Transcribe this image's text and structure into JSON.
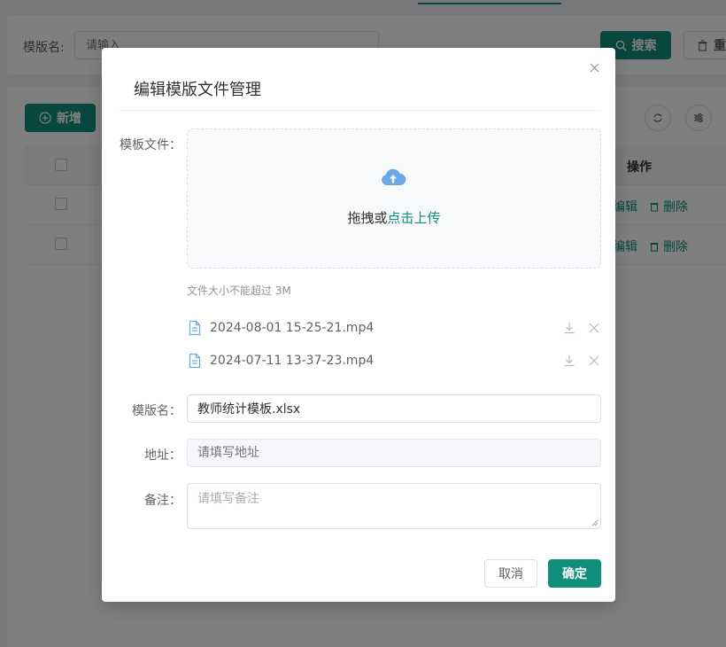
{
  "background": {
    "search": {
      "label": "模版名:",
      "placeholder": "请输入",
      "search_button": "搜索",
      "reset_button": "重置"
    },
    "toolbar": {
      "add_button": "新增"
    },
    "table": {
      "operation_header": "操作",
      "rows": [
        {
          "edit": "编辑",
          "delete": "删除"
        },
        {
          "edit": "编辑",
          "delete": "删除"
        }
      ]
    }
  },
  "dialog": {
    "title": "编辑模版文件管理",
    "upload": {
      "label": "模板文件：",
      "text_prefix": "拖拽或",
      "text_link": "点击上传",
      "tip": "文件大小不能超过 3M",
      "files": [
        {
          "name": "2024-08-01 15-25-21.mp4"
        },
        {
          "name": "2024-07-11 13-37-23.mp4"
        }
      ]
    },
    "name": {
      "label": "模版名：",
      "value": "教师统计模板.xlsx"
    },
    "address": {
      "label": "地址：",
      "placeholder": "请填写地址"
    },
    "remark": {
      "label": "备注：",
      "placeholder": "请填写备注"
    },
    "cancel_button": "取消",
    "confirm_button": "确定"
  },
  "colors": {
    "primary": "#0f8f7c",
    "upload_icon": "#6aa8e8"
  }
}
